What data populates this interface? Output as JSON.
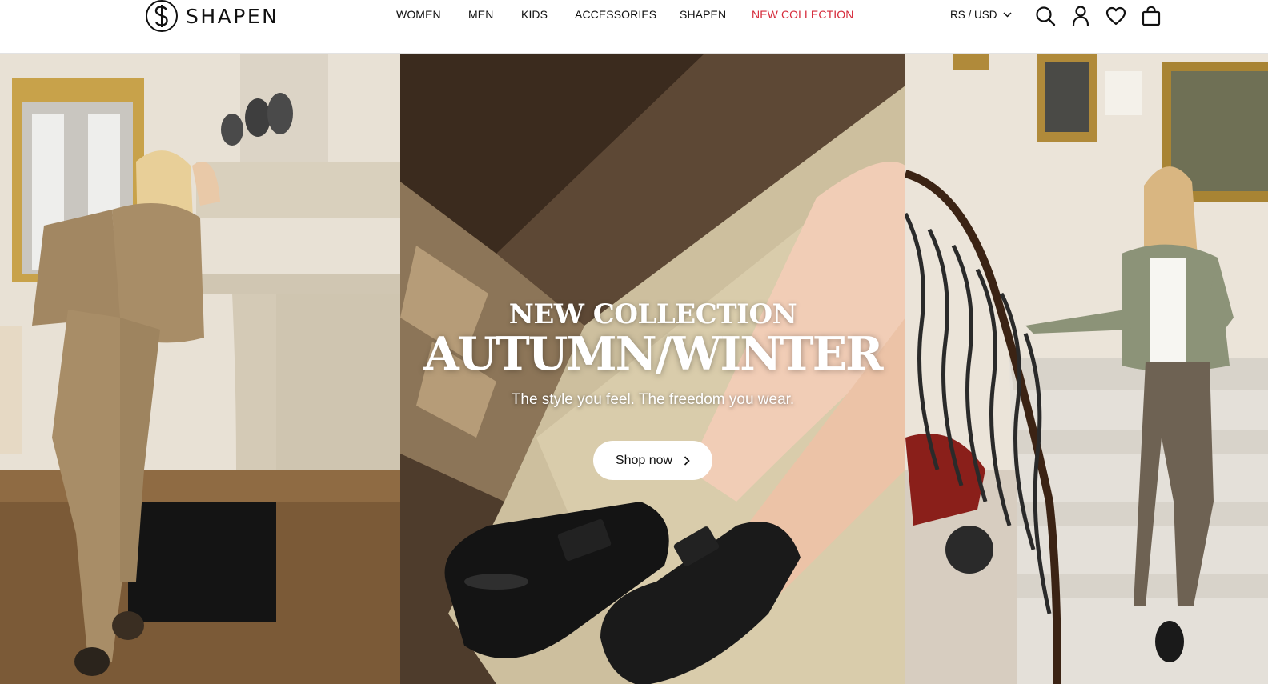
{
  "brand": {
    "name": "SHAPEN"
  },
  "nav": {
    "items": [
      {
        "label": "WOMEN"
      },
      {
        "label": "MEN"
      },
      {
        "label": "KIDS"
      },
      {
        "label": "ACCESSORIES"
      },
      {
        "label": "SHAPEN"
      },
      {
        "label": "NEW COLLECTION",
        "accent": true
      }
    ]
  },
  "header": {
    "currency_label": "RS / USD",
    "icons": [
      "search-icon",
      "account-icon",
      "wishlist-heart-icon",
      "shopping-bag-icon"
    ]
  },
  "hero": {
    "kicker": "NEW COLLECTION",
    "title": "AUTUMN/WINTER",
    "subtitle": "The style you feel. The freedom you wear.",
    "cta_label": "Shop now"
  },
  "colors": {
    "accent": "#d62a3a",
    "text": "#111111",
    "button_bg": "#ffffff"
  }
}
